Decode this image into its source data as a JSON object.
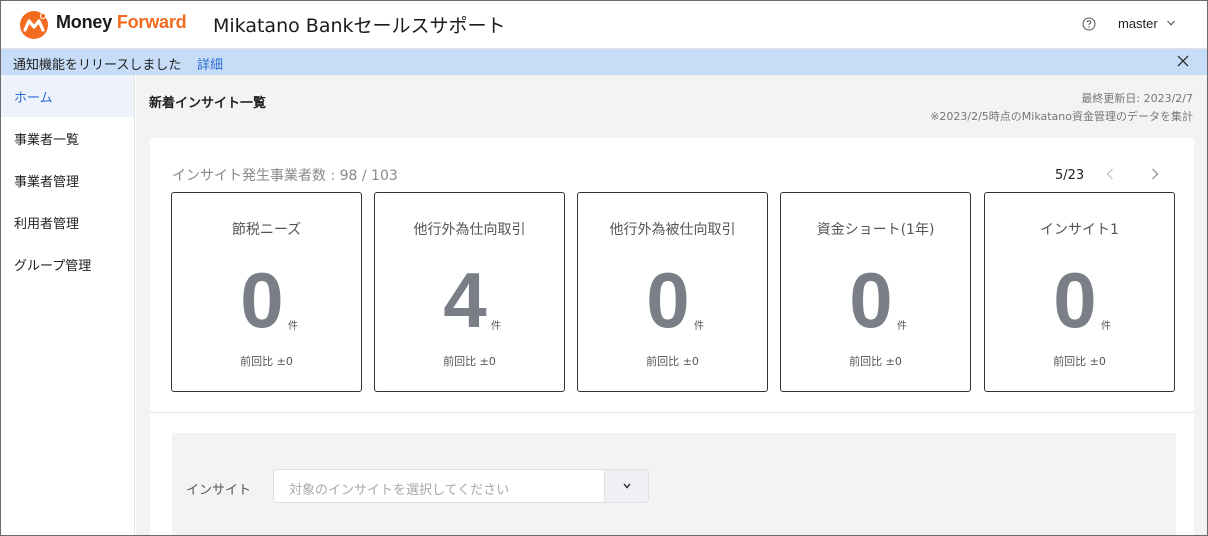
{
  "header": {
    "brand_money": "Money ",
    "brand_forward": "Forward",
    "product_title": "Mikatano Bankセールスサポート",
    "user_name": "master",
    "colors": {
      "brand_orange": "#f26b1f",
      "accent_blue": "#2b6fd6"
    }
  },
  "notice": {
    "text": "通知機能をリリースしました",
    "link": "詳細"
  },
  "sidebar": {
    "items": [
      {
        "label": "ホーム",
        "active": true
      },
      {
        "label": "事業者一覧"
      },
      {
        "label": "事業者管理"
      },
      {
        "label": "利用者管理"
      },
      {
        "label": "グループ管理"
      }
    ]
  },
  "main": {
    "title": "新着インサイト一覧",
    "updated": "最終更新日: 2023/2/7",
    "note": "※2023/2/5時点のMikatano資金管理のデータを集計",
    "count_label": "インサイト発生事業者数 : 98 / 103",
    "pager": "5/23",
    "tiles": [
      {
        "title": "節税ニーズ",
        "value": "0",
        "unit": "件",
        "diff": "前回比 ±0"
      },
      {
        "title": "他行外為仕向取引",
        "value": "4",
        "unit": "件",
        "diff": "前回比 ±0"
      },
      {
        "title": "他行外為被仕向取引",
        "value": "0",
        "unit": "件",
        "diff": "前回比 ±0"
      },
      {
        "title": "資金ショート(1年)",
        "value": "0",
        "unit": "件",
        "diff": "前回比 ±0"
      },
      {
        "title": "インサイト1",
        "value": "0",
        "unit": "件",
        "diff": "前回比 ±0"
      }
    ],
    "filter": {
      "label": "インサイト",
      "placeholder": "対象のインサイトを選択してください"
    }
  }
}
